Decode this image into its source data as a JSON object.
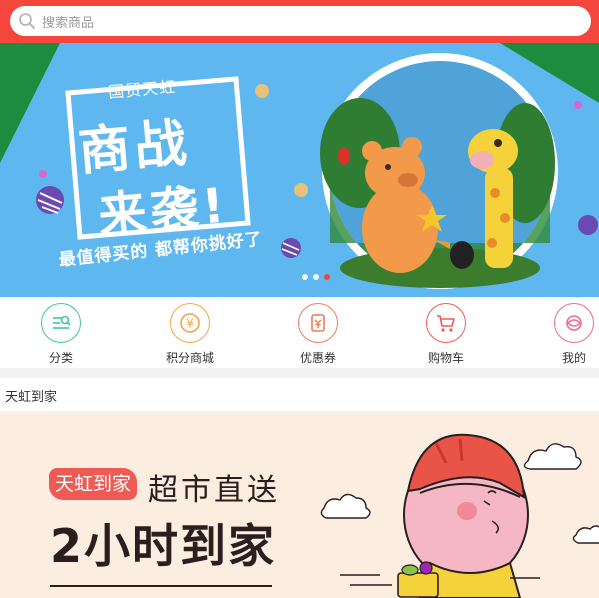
{
  "search": {
    "placeholder": "搜索商品",
    "icon": "search-icon"
  },
  "banner": {
    "brand": "国贸天虹",
    "headline_line1": "商战",
    "headline_line2": "来袭!",
    "slogan": "最值得买的 都帮你挑好了",
    "slide_count": 3,
    "active_slide": 3
  },
  "nav": {
    "items": [
      {
        "label": "分类",
        "icon": "category-icon",
        "color": "#3fc6a0"
      },
      {
        "label": "积分商城",
        "icon": "yen-coin-icon",
        "color": "#f0a64a"
      },
      {
        "label": "优惠券",
        "icon": "coupon-icon",
        "color": "#ef7b5a"
      },
      {
        "label": "购物车",
        "icon": "cart-icon",
        "color": "#ef5b54"
      },
      {
        "label": "我的",
        "icon": "profile-icon",
        "color": "#ef6a8a"
      }
    ]
  },
  "section": {
    "title": "天虹到家"
  },
  "promo": {
    "tag": "天虹到家",
    "line1": "超市直送",
    "line2": "2小时到家"
  },
  "colors": {
    "accent": "#f4463c",
    "banner_sky": "#5fb7ef",
    "banner_green": "#1e8c3e",
    "promo_bg": "#fbeee0"
  }
}
